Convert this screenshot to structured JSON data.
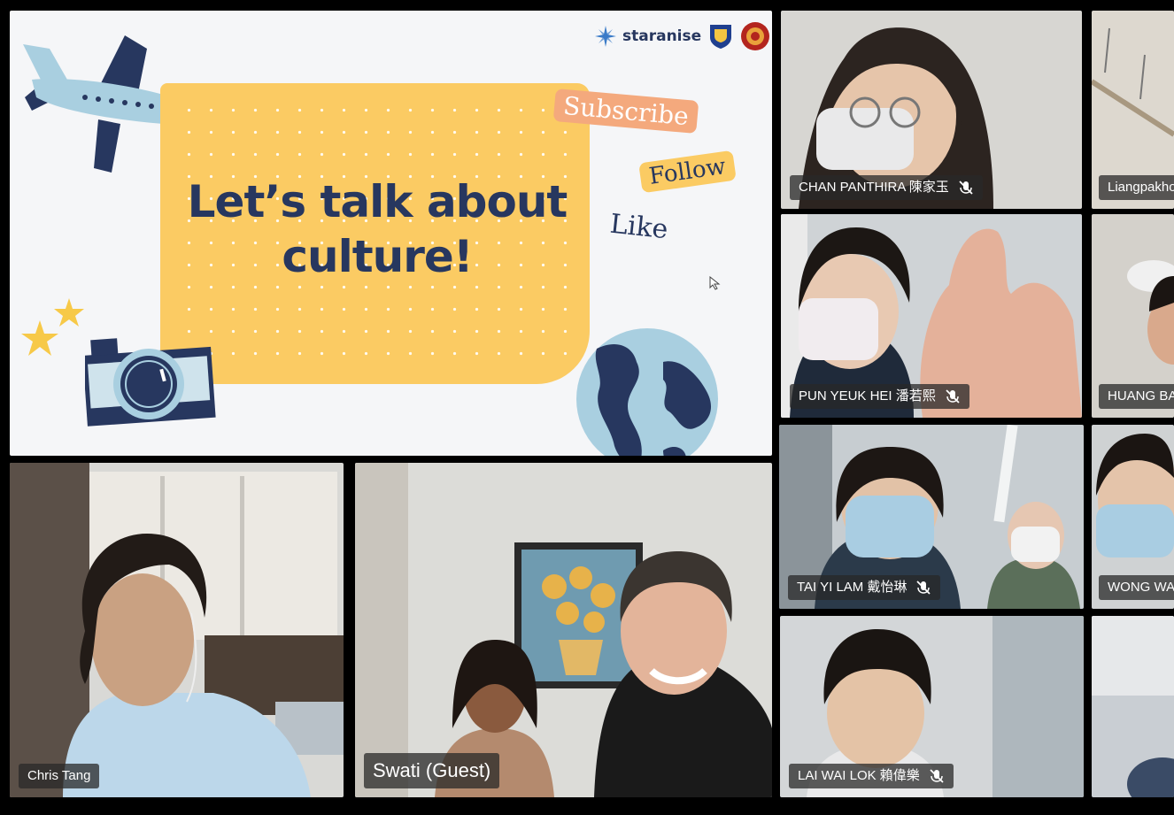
{
  "slide": {
    "brand": "staranise",
    "title_line1": "Let’s talk about",
    "title_line2": "culture!",
    "sticker_subscribe": "Subscribe",
    "sticker_follow": "Follow",
    "sticker_like": "Like"
  },
  "participants": {
    "chris": "Chris Tang",
    "swati": "Swati (Guest)",
    "chan": "CHAN PANTHIRA 陳家玉",
    "liang": "Liangpakho",
    "pun": "PUN YEUK HEI 潘若熙",
    "huang": "HUANG BAI",
    "tai": "TAI YI LAM 戴怡琳",
    "wong": "WONG WAI",
    "lai": "LAI WAI LOK 賴偉樂"
  },
  "colors": {
    "slide_navy": "#27375f",
    "slide_yellow": "#fbcb63",
    "slide_peach": "#f4a97d",
    "sky": "#a9cfe0"
  },
  "icons": {
    "muted": "mic-off-icon"
  }
}
